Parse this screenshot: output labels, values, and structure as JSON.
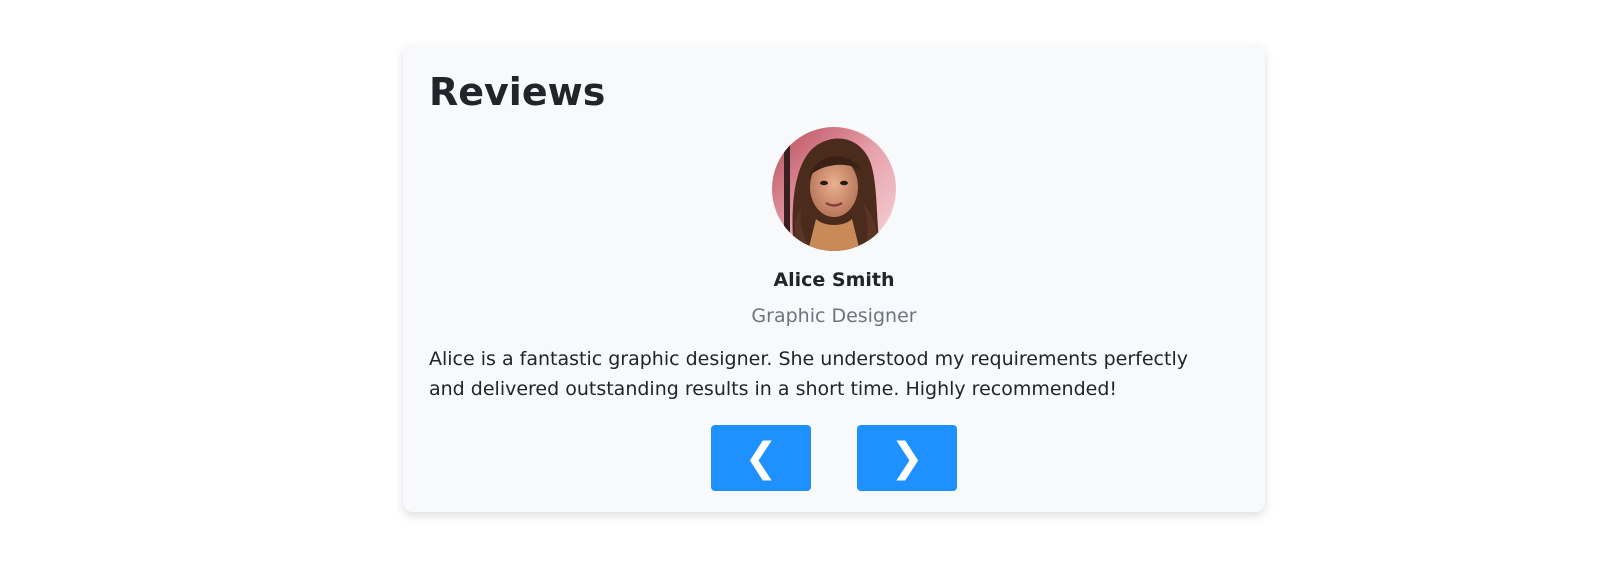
{
  "section": {
    "title": "Reviews"
  },
  "review": {
    "name": "Alice Smith",
    "role": "Graphic Designer",
    "text": "Alice is a fantastic graphic designer. She understood my requirements perfectly and delivered outstanding results in a short time. Highly recommended!"
  },
  "controls": {
    "prev_label": "❮",
    "next_label": "❯",
    "accent_color": "#1e90ff"
  }
}
